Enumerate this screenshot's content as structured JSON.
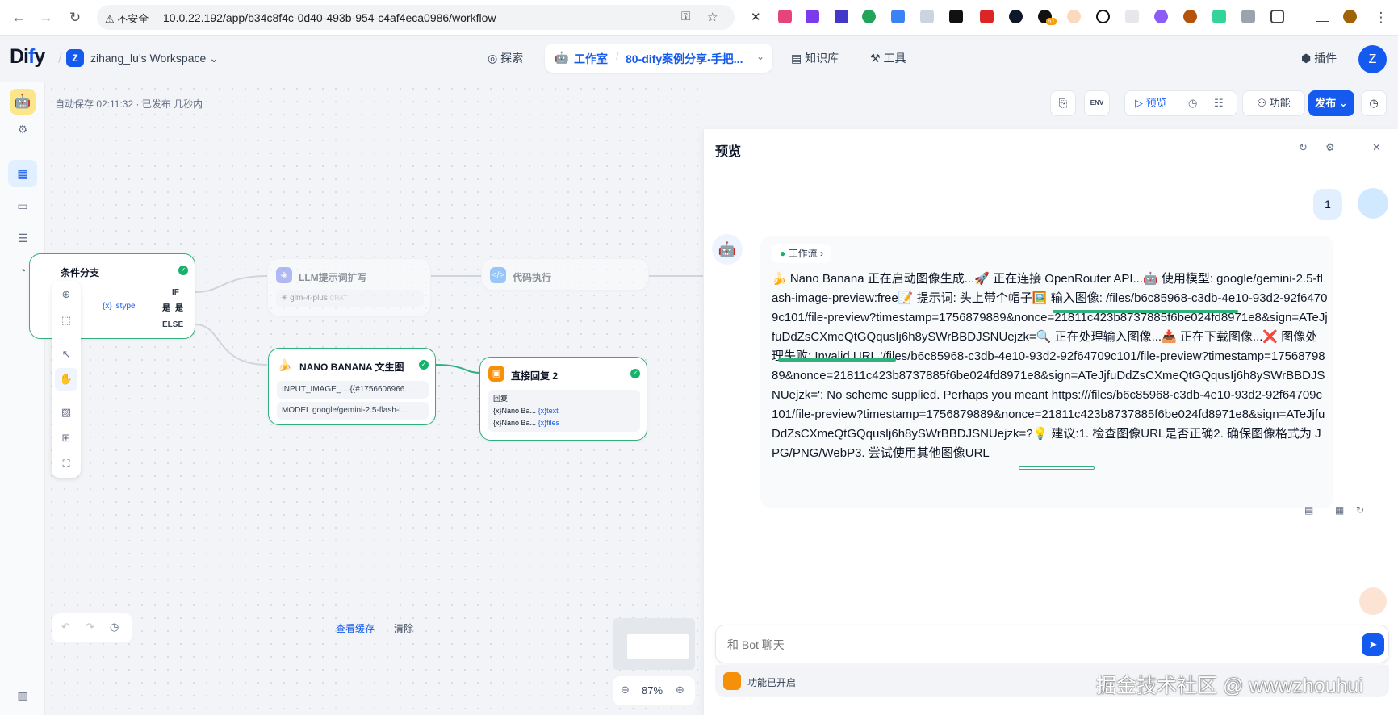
{
  "browser": {
    "security_label": "不安全",
    "url": "10.0.22.192/app/b34c8f4c-0d40-493b-954-c4af4eca0986/workflow",
    "ext_badge": "61"
  },
  "app": {
    "logo_text": "Dify",
    "workspace_initial": "Z",
    "workspace_name": "zihang_lu's Workspace",
    "nav": {
      "explore": "探索",
      "studio": "工作室",
      "app_name": "80-dify案例分享-手把...",
      "knowledge": "知识库",
      "tools": "工具",
      "plugins": "插件"
    },
    "user_initial": "Z"
  },
  "workflow": {
    "autosave": "自动保存 02:11:32 · 已发布 几秒内",
    "toolbar": {
      "env_label": "ENV",
      "preview": "预览",
      "features": "功能",
      "publish": "发布"
    },
    "nodes": {
      "if_else": {
        "title": "条件分支",
        "if": "IF",
        "var": "{x} istype",
        "op": "是",
        "else": "ELSE"
      },
      "llm": {
        "title": "LLM提示词扩写",
        "model": "glm-4-plus",
        "mode": "CHAT"
      },
      "code": {
        "title": "代码执行"
      },
      "nano": {
        "title": "NANO BANANA 文生图",
        "row1_key": "INPUT_IMAGE_...",
        "row1_val": "{{#1756606966...",
        "row2_key": "MODEL",
        "row2_val": "google/gemini-2.5-flash-i..."
      },
      "answer": {
        "title": "直接回复 2",
        "label": "回复",
        "line1_a": "{x}Nano Ba...",
        "line1_b": "{x}text",
        "line2_a": "{x}Nano Ba...",
        "line2_b": "{x}files"
      }
    },
    "bottom": {
      "view_cache": "查看缓存",
      "clear": "清除",
      "zoom": "87%"
    }
  },
  "preview": {
    "title": "预览",
    "user_message": "1",
    "workflow_chip": "工作流",
    "answer": "🍌 Nano Banana 正在启动图像生成...🚀 正在连接 OpenRouter API...🤖 使用模型: google/gemini-2.5-flash-image-preview:free📝 提示词: 头上带个帽子🖼️ 输入图像: /files/b6c85968-c3db-4e10-93d2-92f64709c101/file-preview?timestamp=1756879889&nonce=21811c423b8737885f6be024fd8971e8&sign=ATeJjfuDdZsCXmeQtGQqusIj6h8ySWrBBDJSNUejzk=🔍 正在处理输入图像...📥 正在下载图像...❌ 图像处理失败: Invalid URL '/files/b6c85968-c3db-4e10-93d2-92f64709c101/file-preview?timestamp=1756879889&nonce=21811c423b8737885f6be024fd8971e8&sign=ATeJjfuDdZsCXmeQtGQqusIj6h8ySWrBBDJSNUejzk=': No scheme supplied. Perhaps you meant https:///files/b6c85968-c3db-4e10-93d2-92f64709c101/file-preview?timestamp=1756879889&nonce=21811c423b8737885f6be024fd8971e8&sign=ATeJjfuDdZsCXmeQtGQqusIj6h8ySWrBBDJSNUejzk=?💡 建议:1. 检查图像URL是否正确2. 确保图像格式为 JPG/PNG/WebP3. 尝试使用其他图像URL",
    "input_placeholder": "和 Bot 聊天",
    "features_enabled": "功能已开启"
  },
  "watermark": "掘金技术社区 @ wwwzhouhui",
  "colors": {
    "accent": "#155aef",
    "success": "#17b26a",
    "selected_border": "#2fb07d"
  }
}
